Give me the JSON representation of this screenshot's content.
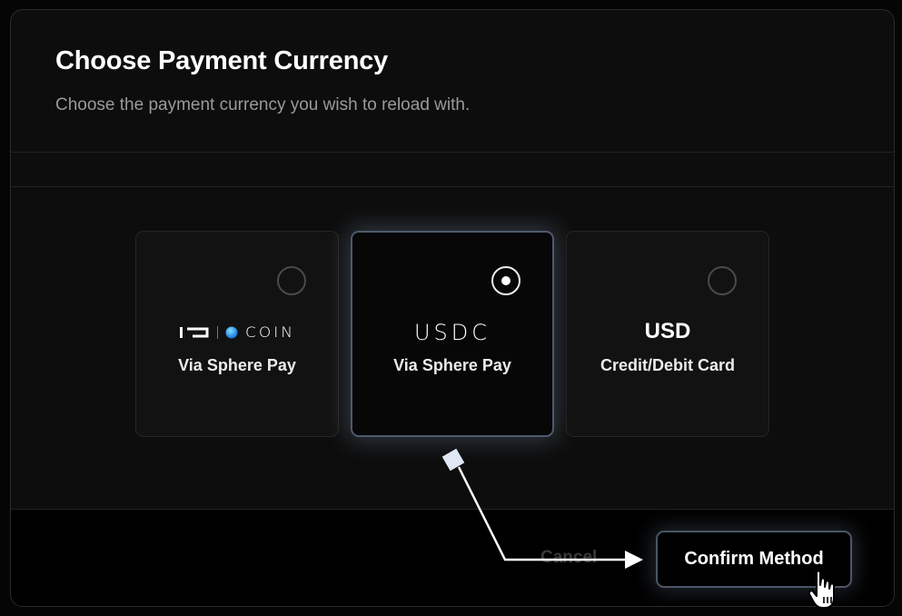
{
  "modal": {
    "title": "Choose Payment Currency",
    "subtitle": "Choose the payment currency you wish to reload with."
  },
  "options": [
    {
      "logo_icon": "io-coin-logo",
      "logo_text": "COIN",
      "subtitle": "Via Sphere Pay",
      "selected": false
    },
    {
      "logo_icon": "usdc-logo",
      "logo_text": "USDC",
      "subtitle": "Via Sphere Pay",
      "selected": true
    },
    {
      "logo_text": "USD",
      "subtitle": "Credit/Debit Card",
      "selected": false
    }
  ],
  "footer": {
    "cancel_label": "Cancel",
    "confirm_label": "Confirm Method"
  },
  "colors": {
    "background": "#050505",
    "modal": "#0d0d0d",
    "card": "#121212",
    "selected_border": "#4d5a6c",
    "text": "#ffffff",
    "subtext": "#9a9a9a"
  }
}
